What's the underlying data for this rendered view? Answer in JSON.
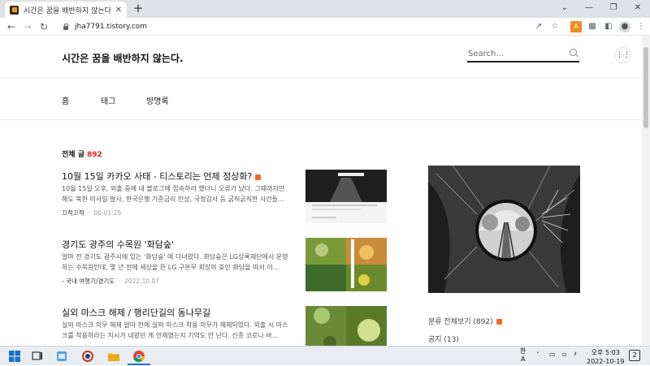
{
  "browser": {
    "tab_title": "시간은 꿈을 배반하지 않는다.",
    "tab_close": "✕",
    "new_tab": "+",
    "url": "jha7791.tistory.com",
    "win_min": "⌄",
    "win_minimize": "—",
    "win_restore": "❐",
    "win_close": "✕",
    "ext_label": "A"
  },
  "blog": {
    "title": "시간은 꿈을 배반하지 않는다.",
    "search_placeholder": "Search...",
    "nav": [
      "홈",
      "태그",
      "방명록"
    ],
    "total_label": "전체 글",
    "total_count": "892"
  },
  "posts": [
    {
      "title": "10월 15일 카카오 사태 - 티스토리는 언제 정상화?",
      "excerpt": "10월 15일 오후, 외출 중에 내 블로그에 접속하려 했더니 오류가 났다. 그때까지만 해도 북한 미사일 발사, 한국은행 기준금리 인상, 국정감사 등 굵직굵직한 사건들...",
      "category": "끄적끄적",
      "date": "00:01:25"
    },
    {
      "title": "경기도 광주의 수목원 '화담숲'",
      "excerpt": "얼마 전 경기도 광주시에 있는 '화담숲' 에 다녀왔다. 화담숲은 LG상록재단에서 운영하는 수목원인데, 몇 년 전에 세상을 뜬 LG 구본무 회장의 호인 화담을 따서 이...",
      "category": "- 국내 여행기/경기도",
      "date": "2022.10.07"
    },
    {
      "title": "실외 마스크 해제 / 행리단길의 동나무길",
      "excerpt": "실외 마스크 의무 해제 얼마 전에 실외 마스크 착용 의무가 해제되었다. 외출 시 마스크를 착용하라는 지시가 내왔던 게 언제였는지 기억도 안 난다. 신종 코로나 바...",
      "category": "",
      "date": ""
    }
  ],
  "sidebar": {
    "categories": [
      {
        "label": "분류 전체보기 (892)",
        "new": true
      },
      {
        "label": "공지 (13)",
        "new": false
      }
    ]
  },
  "taskbar": {
    "ime_top": "한",
    "ime_bottom": "A",
    "time": "오후 5:03",
    "date": "2022-10-19",
    "notif_count": "2"
  },
  "colors": {
    "accent_red": "#e2231a",
    "new_badge": "#f06b2c",
    "ext_orange": "#f08a24"
  }
}
